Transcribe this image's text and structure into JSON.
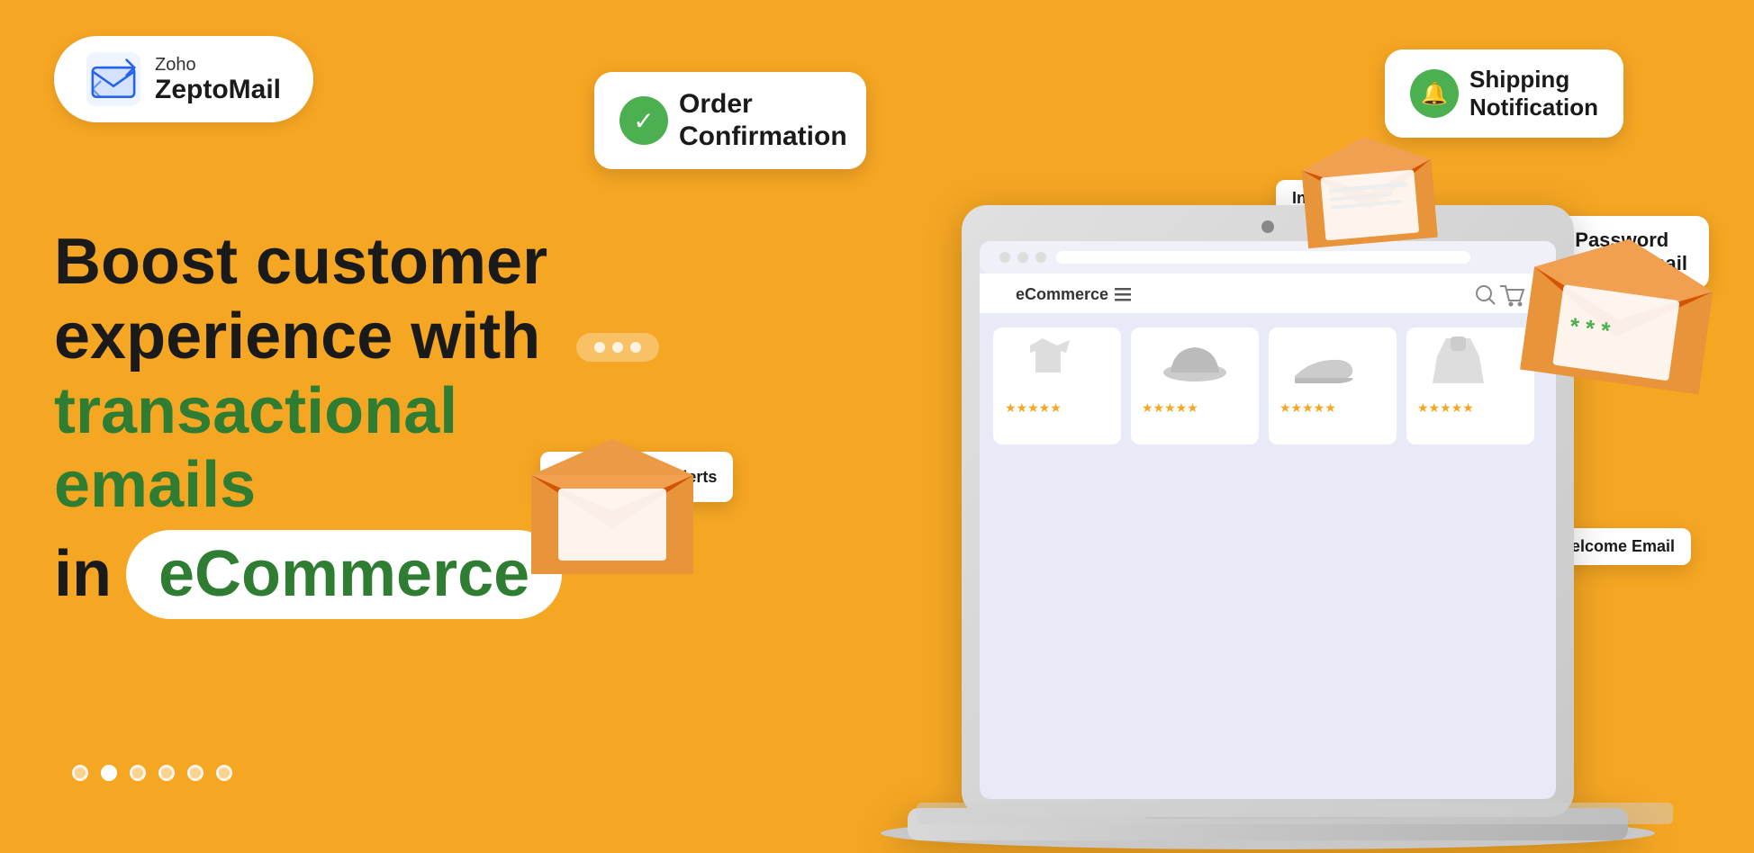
{
  "logo": {
    "zoho_label": "Zoho",
    "brand_label": "ZeptoMail"
  },
  "hero": {
    "line1": "Boost customer",
    "line2": "experience with",
    "line3": "transactional emails",
    "line4_in": "in",
    "line4_highlight": "eCommerce"
  },
  "bubbles": {
    "order_confirmation": "Order\nConfirmation",
    "shipping_notification": "Shipping\nNotification",
    "invoice_emails": "Invoice Emails",
    "password_reset": "Password\nReset Email",
    "payment_alerts": "Payment Alerts",
    "welcome_email": "Welcome Email"
  },
  "screen": {
    "brand": "eCommerce",
    "products": [
      {
        "name": "T-Shirt",
        "stars": 5
      },
      {
        "name": "Hat",
        "stars": 5
      },
      {
        "name": "Shoes",
        "stars": 5
      },
      {
        "name": "Dress",
        "stars": 5
      }
    ]
  },
  "colors": {
    "background": "#F5A623",
    "green": "#4caf50",
    "dark": "#1a1a1a",
    "text_green": "#2e7d32"
  }
}
